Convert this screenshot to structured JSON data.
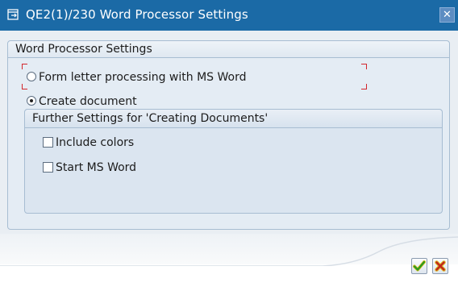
{
  "window": {
    "title": "QE2(1)/230 Word Processor Settings",
    "title_icon": "window-dialog-icon",
    "close_icon": "close-icon"
  },
  "group": {
    "title": "Word Processor Settings",
    "options": [
      {
        "label": "Form letter processing with MS Word",
        "selected": false,
        "focused": true
      },
      {
        "label": "Create document",
        "selected": true,
        "focused": false
      }
    ]
  },
  "subgroup": {
    "title": "Further Settings for 'Creating Documents'",
    "checkboxes": [
      {
        "label": "Include colors",
        "checked": false
      },
      {
        "label": "Start MS Word",
        "checked": false
      }
    ]
  },
  "footer": {
    "confirm_icon": "checkmark-icon",
    "cancel_icon": "cancel-x-icon",
    "confirm_color": "#2b9a1e",
    "cancel_color": "#c0281e"
  }
}
